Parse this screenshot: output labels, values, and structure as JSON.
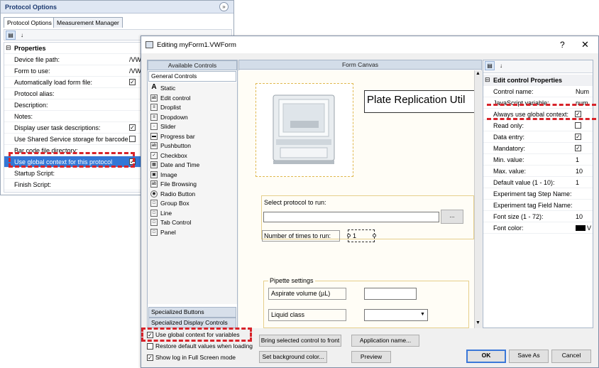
{
  "back": {
    "title": "Protocol Options",
    "tabs": [
      "Protocol Options",
      "Measurement Manager"
    ],
    "category": "Properties",
    "rows": [
      {
        "label": "Device file path:",
        "value": "/VW",
        "type": "text"
      },
      {
        "label": "Form to use:",
        "value": "/VW",
        "type": "text"
      },
      {
        "label": "Automatically load form file:",
        "checked": "✓",
        "type": "check"
      },
      {
        "label": "Protocol alias:",
        "type": "text"
      },
      {
        "label": "Description:",
        "type": "text"
      },
      {
        "label": "Notes:",
        "type": "text"
      },
      {
        "label": "Display user task descriptions:",
        "checked": "✓",
        "type": "check"
      },
      {
        "label": "Use Shared Service storage for barcode",
        "checked": "",
        "type": "check"
      },
      {
        "label": "Bar code file directory:",
        "type": "text"
      },
      {
        "label": "Use global context for this protocol",
        "checked": "✓",
        "type": "check",
        "selected": true
      },
      {
        "label": "Startup Script:",
        "type": "text"
      },
      {
        "label": "Finish Script:",
        "type": "text"
      }
    ]
  },
  "dialog": {
    "title": "Editing myForm1.VWForm",
    "help": "?",
    "close": "✕",
    "left_header": "Available Controls",
    "canvas_header": "Form Canvas",
    "section_general": "General Controls",
    "controls": [
      {
        "label": "Static",
        "icon": "A"
      },
      {
        "label": "Edit control",
        "icon": "ab"
      },
      {
        "label": "Droplist",
        "icon": "≡"
      },
      {
        "label": "Dropdown",
        "icon": "≡"
      },
      {
        "label": "Slider",
        "icon": "-"
      },
      {
        "label": "Progress bar",
        "icon": "▬"
      },
      {
        "label": "Pushbutton",
        "icon": "ab"
      },
      {
        "label": "Checkbox",
        "icon": "✓"
      },
      {
        "label": "Date and Time",
        "icon": "▦"
      },
      {
        "label": "Image",
        "icon": "▣"
      },
      {
        "label": "File Browsing",
        "icon": "ab"
      },
      {
        "label": "Radio Button",
        "icon": "◉"
      },
      {
        "label": "Group Box",
        "icon": "□"
      },
      {
        "label": "Line",
        "icon": "□"
      },
      {
        "label": "Tab Control",
        "icon": "□"
      },
      {
        "label": "Panel",
        "icon": "□"
      }
    ],
    "section_buttons": "Specialized Buttons",
    "section_display": "Specialized Display Controls",
    "canvas": {
      "title_text": "Plate Replication Util",
      "select_label": "Select protocol to run:",
      "browse_button": "...",
      "times_label": "Number of times to run:",
      "times_value": "1",
      "pipette_group": "Pipette settings",
      "aspirate_label": "Aspirate volume (µL)",
      "liquid_label": "Liquid class"
    },
    "right_header": "Edit control Properties",
    "props": [
      {
        "label": "Control name:",
        "value": "Num",
        "type": "text"
      },
      {
        "label": "JavaScript variable:",
        "value": "num",
        "type": "text"
      },
      {
        "label": "Always use global context:",
        "checked": "✓",
        "type": "check"
      },
      {
        "label": "Read only:",
        "checked": "",
        "type": "check"
      },
      {
        "label": "Data entry:",
        "checked": "✓",
        "type": "check"
      },
      {
        "label": "Mandatory:",
        "checked": "✓",
        "type": "check"
      },
      {
        "label": "Min. value:",
        "value": "1",
        "type": "text"
      },
      {
        "label": "Max. value:",
        "value": "10",
        "type": "text"
      },
      {
        "label": "Default value (1 - 10):",
        "value": "1",
        "type": "text"
      },
      {
        "label": "Experiment tag Step Name:",
        "value": "",
        "type": "text"
      },
      {
        "label": "Experiment tag Field Name:",
        "value": "",
        "type": "text"
      },
      {
        "label": "Font size (1 - 72):",
        "value": "10",
        "type": "text"
      },
      {
        "label": "Font color:",
        "value": "V",
        "type": "color",
        "color": "#000000"
      }
    ],
    "bottom": {
      "use_global": "Use global context for variables",
      "restore_defaults": "Restore default values when loading",
      "show_log": "Show log in Full Screen mode",
      "use_global_checked": "✓",
      "restore_checked": "",
      "show_log_checked": "✓",
      "bring_front": "Bring selected control to front",
      "app_name": "Application name...",
      "set_bg": "Set background color...",
      "preview": "Preview",
      "ok": "OK",
      "save_as": "Save As",
      "cancel": "Cancel"
    }
  },
  "colors": {
    "highlight": "#d8232a",
    "selection": "#3377d6",
    "header": "#d3dde9"
  }
}
